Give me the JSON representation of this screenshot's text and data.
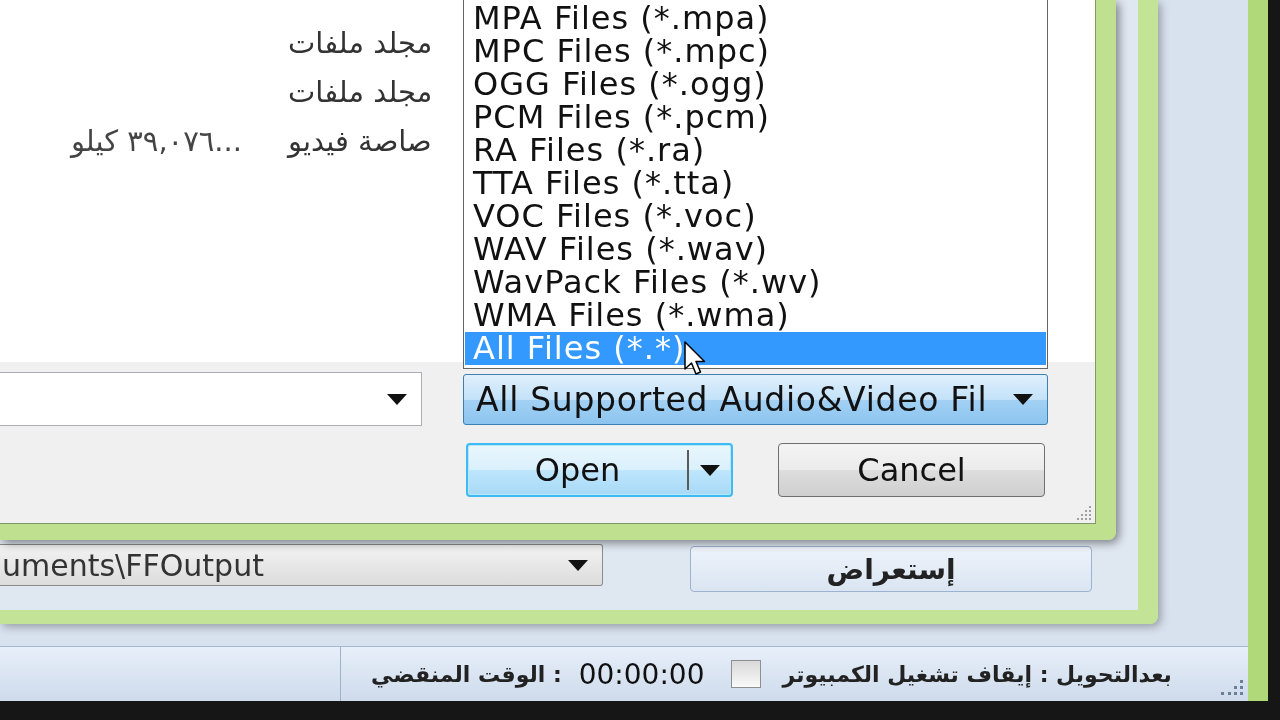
{
  "file_dialog": {
    "file_list": {
      "rows": [
        {
          "cells": [
            "مجلد ملفات"
          ]
        },
        {
          "cells": [
            "مجلد ملفات"
          ]
        },
        {
          "cells": [
            "صاصة فيديو",
            "...٣٩,٠٧٦ كيلو"
          ]
        }
      ]
    },
    "file_type": {
      "value": "All Supported Audio&Video Fil",
      "expanded": true,
      "options": [
        {
          "label": "MPA Files (*.mpa)",
          "selected": false
        },
        {
          "label": "MPC Files (*.mpc)",
          "selected": false
        },
        {
          "label": "OGG Files (*.ogg)",
          "selected": false
        },
        {
          "label": "PCM Files (*.pcm)",
          "selected": false
        },
        {
          "label": "RA Files (*.ra)",
          "selected": false
        },
        {
          "label": "TTA Files (*.tta)",
          "selected": false
        },
        {
          "label": "VOC Files (*.voc)",
          "selected": false
        },
        {
          "label": "WAV Files (*.wav)",
          "selected": false
        },
        {
          "label": "WavPack Files (*.wv)",
          "selected": false
        },
        {
          "label": "WMA Files (*.wma)",
          "selected": false
        },
        {
          "label": "All Files (*.*)",
          "selected": true
        }
      ]
    },
    "open_button": {
      "label": "Open",
      "split": true,
      "default": true
    },
    "cancel_button": {
      "label": "Cancel",
      "default": false
    }
  },
  "settings_window": {
    "output_folder": "uments\\FFOutput",
    "browse_button": "إستعراض"
  },
  "status_bar": {
    "elapsed_label": "الوقت المنقضي :",
    "elapsed_time": "00:00:00",
    "shutdown": {
      "label": "بعدالتحويل : إيقاف تشغيل الكمبيوتر",
      "checked": false
    }
  }
}
